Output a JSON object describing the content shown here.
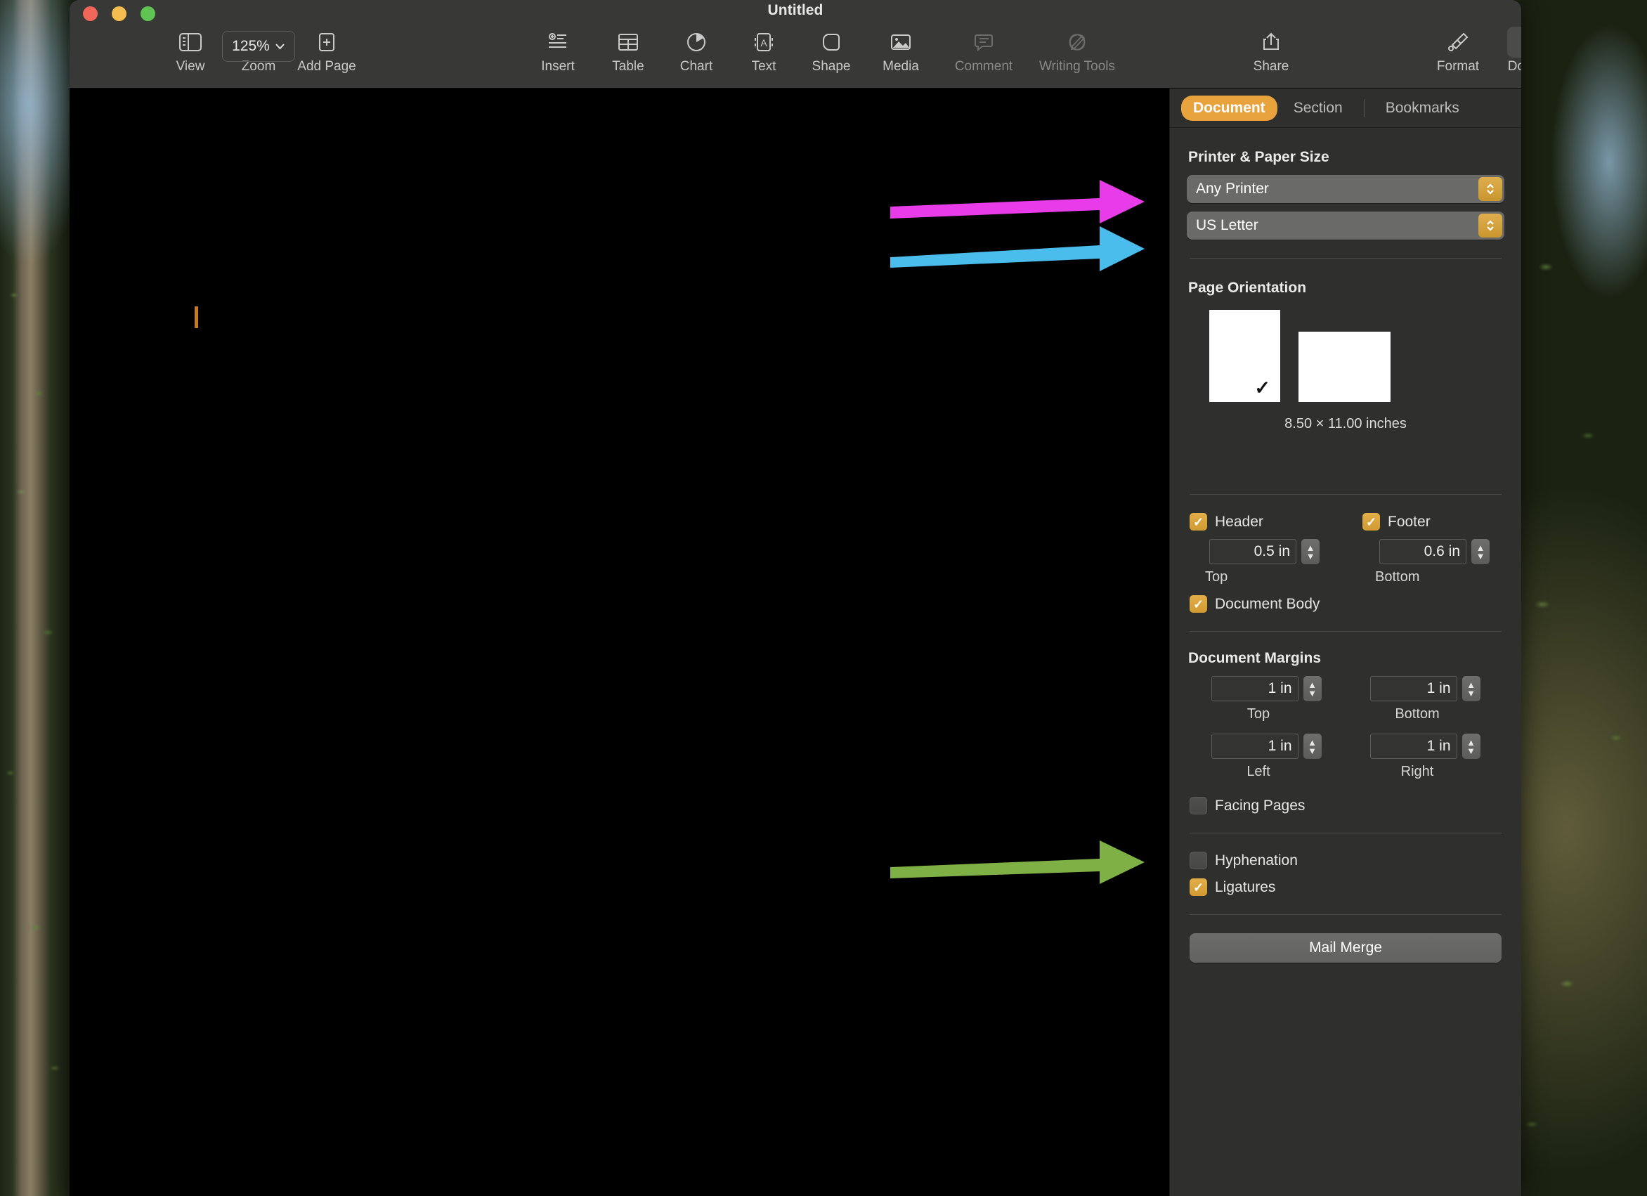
{
  "window": {
    "title": "Untitled",
    "traffic_lights": [
      "close-red",
      "minimize-yellow",
      "maximize-green"
    ]
  },
  "toolbar": {
    "items": [
      {
        "label": "View",
        "icon": "sidebar-icon",
        "enabled": true,
        "selected": false
      },
      {
        "label": "Zoom",
        "icon": "zoom-chevron-icon",
        "enabled": true,
        "selected": false
      },
      {
        "label": "Add Page",
        "icon": "add-page-icon",
        "enabled": true,
        "selected": false
      },
      {
        "label": "Insert",
        "icon": "insert-icon",
        "enabled": true,
        "selected": false
      },
      {
        "label": "Table",
        "icon": "table-icon",
        "enabled": true,
        "selected": false
      },
      {
        "label": "Chart",
        "icon": "chart-pie-icon",
        "enabled": true,
        "selected": false
      },
      {
        "label": "Text",
        "icon": "text-box-icon",
        "enabled": true,
        "selected": false
      },
      {
        "label": "Shape",
        "icon": "shape-icon",
        "enabled": true,
        "selected": false
      },
      {
        "label": "Media",
        "icon": "media-image-icon",
        "enabled": true,
        "selected": false
      },
      {
        "label": "Comment",
        "icon": "comment-icon",
        "enabled": false,
        "selected": false
      },
      {
        "label": "Writing Tools",
        "icon": "writing-tools-icon",
        "enabled": false,
        "selected": false
      },
      {
        "label": "Share",
        "icon": "share-icon",
        "enabled": true,
        "selected": false
      },
      {
        "label": "Format",
        "icon": "format-brush-icon",
        "enabled": true,
        "selected": false
      },
      {
        "label": "Document",
        "icon": "document-icon",
        "enabled": true,
        "selected": true
      }
    ],
    "zoom_value": "125%"
  },
  "inspector": {
    "tabs": [
      {
        "label": "Document",
        "active": true
      },
      {
        "label": "Section",
        "active": false
      },
      {
        "label": "Bookmarks",
        "active": false
      }
    ],
    "printer_paper": {
      "title": "Printer & Paper Size",
      "printer": "Any Printer",
      "paper_size": "US Letter"
    },
    "page_orientation": {
      "title": "Page Orientation",
      "portrait_selected": true,
      "landscape_selected": false,
      "size_text": "8.50 × 11.00 inches"
    },
    "header_footer": {
      "header": {
        "label": "Header",
        "checked": true,
        "value": "0.5 in",
        "caption": "Top"
      },
      "footer": {
        "label": "Footer",
        "checked": true,
        "value": "0.6 in",
        "caption": "Bottom"
      },
      "document_body": {
        "label": "Document Body",
        "checked": true
      }
    },
    "margins": {
      "title": "Document Margins",
      "top": {
        "value": "1 in",
        "caption": "Top"
      },
      "bottom": {
        "value": "1 in",
        "caption": "Bottom"
      },
      "left": {
        "value": "1 in",
        "caption": "Left"
      },
      "right": {
        "value": "1 in",
        "caption": "Right"
      },
      "facing_pages": {
        "label": "Facing Pages",
        "checked": false
      }
    },
    "typography": {
      "hyphenation": {
        "label": "Hyphenation",
        "checked": false
      },
      "ligatures": {
        "label": "Ligatures",
        "checked": true
      }
    },
    "mail_merge_label": "Mail Merge"
  },
  "annotations": [
    {
      "name": "arrow-to-printer",
      "color": "#e83ce8",
      "points_to": "Any Printer"
    },
    {
      "name": "arrow-to-paper-size",
      "color": "#4bbdec",
      "points_to": "US Letter"
    },
    {
      "name": "arrow-to-margins",
      "color": "#7fb046",
      "points_to": "Document Margins Top"
    }
  ],
  "colors": {
    "accent_orange": "#e8a33d",
    "window_chrome": "#383836",
    "inspector_bg": "#2f2f2d",
    "canvas": "#000000",
    "caret": "#c8781d"
  }
}
